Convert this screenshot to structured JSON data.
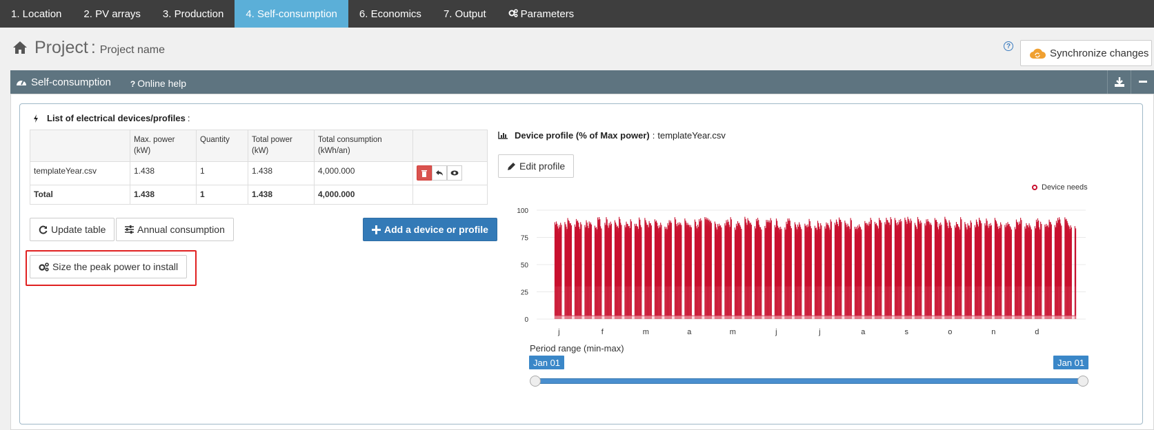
{
  "nav": {
    "tabs": [
      {
        "label": "1. Location"
      },
      {
        "label": "2. PV arrays"
      },
      {
        "label": "3. Production"
      },
      {
        "label": "4. Self-consumption",
        "active": true
      },
      {
        "label": "6. Economics"
      },
      {
        "label": "7. Output"
      },
      {
        "label": "Parameters",
        "icon": "gears-icon"
      }
    ]
  },
  "project": {
    "title": "Project",
    "separator": ":",
    "name": "Project name",
    "sync_label": "Synchronize changes",
    "help_glyph": "?"
  },
  "panel": {
    "title": "Self-consumption",
    "online_help_glyph": "?",
    "online_help": "Online help"
  },
  "devices": {
    "list_title": "List of electrical devices/profiles",
    "list_colon": ":",
    "headers": [
      "",
      "Max. power (kW)",
      "Quantity",
      "Total power (kW)",
      "Total consumption (kWh/an)",
      ""
    ],
    "rows": [
      {
        "name": "templateYear.csv",
        "max_power": "1.438",
        "quantity": "1",
        "total_power": "1.438",
        "total_consumption": "4,000.000"
      }
    ],
    "total": {
      "name": "Total",
      "max_power": "1.438",
      "quantity": "1",
      "total_power": "1.438",
      "total_consumption": "4,000.000"
    }
  },
  "buttons": {
    "update_table": "Update table",
    "annual_consumption": "Annual consumption",
    "add_device": "Add a device or profile",
    "size_peak": "Size the peak power to install",
    "edit_profile": "Edit profile"
  },
  "profile": {
    "title": "Device profile (% of Max power)",
    "separator": ":",
    "file": "templateYear.csv"
  },
  "chart_data": {
    "type": "area",
    "series": [
      {
        "name": "Device needs",
        "color": "#c8102e"
      }
    ],
    "categories": [
      "j",
      "f",
      "m",
      "a",
      "m",
      "j",
      "j",
      "a",
      "s",
      "o",
      "n",
      "d"
    ],
    "yticks": [
      0,
      25,
      50,
      75,
      100
    ],
    "ylim": [
      0,
      100
    ],
    "typical_daily_peak": 88,
    "typical_night_level": 30,
    "weekend_level": 3,
    "max_value": 100,
    "grid": true,
    "legend_position": "top-right"
  },
  "range": {
    "label": "Period range (min-max)",
    "min": "Jan 01",
    "max": "Jan 01"
  },
  "colors": {
    "nav_bg": "#3e3e3e",
    "nav_active": "#5bafd8",
    "panel_bar": "#5e7480",
    "primary": "#337ab7",
    "danger": "#d9534f",
    "series": "#c8102e",
    "highlight": "#e02020"
  }
}
